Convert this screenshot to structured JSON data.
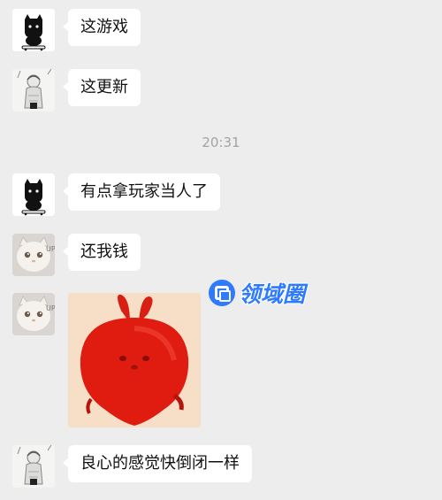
{
  "messages": [
    {
      "sender": "black-cat-avatar",
      "text": "这游戏"
    },
    {
      "sender": "sketch-girl-avatar",
      "text": "这更新"
    },
    {
      "sender": "black-cat-avatar",
      "text": "有点拿玩家当人了"
    },
    {
      "sender": "white-cat-avatar",
      "text": "还我钱"
    },
    {
      "sender": "white-cat-avatar",
      "sticker": "red-bunny-sticker"
    },
    {
      "sender": "sketch-girl-avatar",
      "text": "良心的感觉快倒闭一样"
    }
  ],
  "timestamp": "20:31",
  "watermark": {
    "text": "领域圈"
  },
  "colors": {
    "background": "#ededed",
    "bubble": "#ffffff",
    "timestamp": "#a3a3a3",
    "watermark": "#2f7bff",
    "sticker_red": "#e01b10"
  }
}
